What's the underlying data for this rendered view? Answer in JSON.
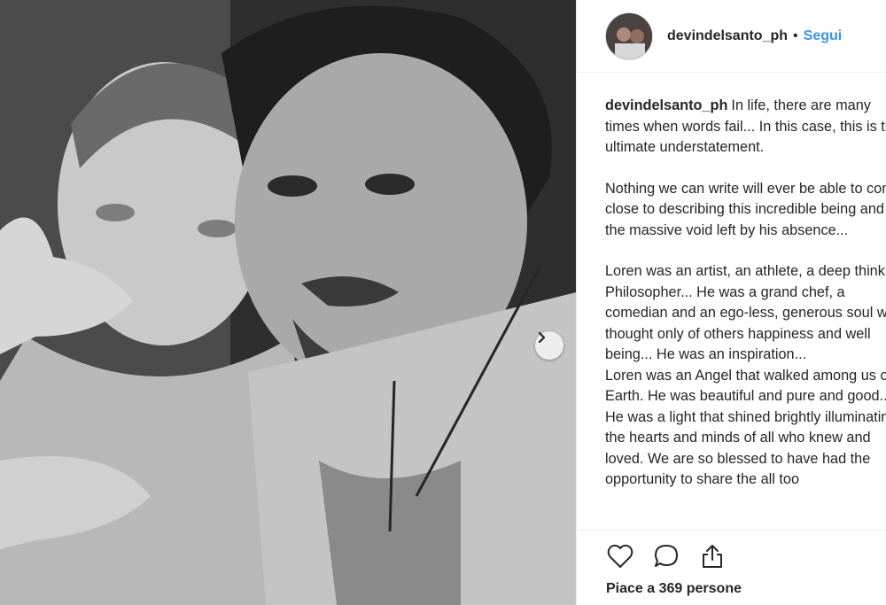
{
  "post": {
    "author": "devindelsanto_ph",
    "separator": "•",
    "follow_label": "Segui"
  },
  "caption": {
    "username": "devindelsanto_ph",
    "first_text": "In life, there are many times when words fail... In this case, this is the ultimate understatement.",
    "paragraph_2": "Nothing we can write will ever be able to come close to describing this incredible being and the massive void left by his absence...",
    "paragraph_3": "Loren was an artist, an athlete, a deep thinking Philosopher... He was a grand chef, a comedian and an ego-less, generous soul who thought only of others happiness and well being... He was an inspiration...",
    "paragraph_4": "Loren was an Angel that walked among us on Earth. He was beautiful and pure and good... He was a light that shined brightly illuminating the hearts and minds of all who knew and loved. We are so blessed to have had the opportunity to share the all too"
  },
  "actions": {
    "like_icon": "heart-icon",
    "comment_icon": "comment-icon",
    "share_icon": "share-icon"
  },
  "likes": {
    "text": "Piace a 369 persone"
  },
  "carousel": {
    "next_icon": "chevron-right-icon"
  },
  "colors": {
    "link_blue": "#3897f0",
    "text": "#262626",
    "border": "#efefef"
  }
}
